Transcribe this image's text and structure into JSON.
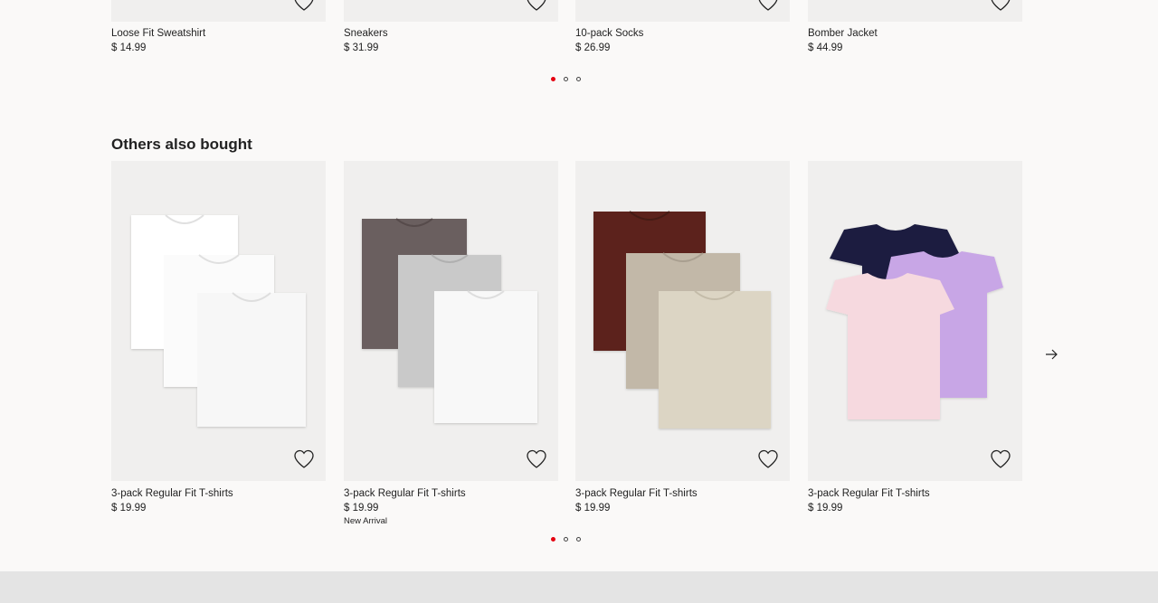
{
  "top_row": {
    "products": [
      {
        "name": "Loose Fit Sweatshirt",
        "price": "$ 14.99"
      },
      {
        "name": "Sneakers",
        "price": "$ 31.99"
      },
      {
        "name": "10-pack Socks",
        "price": "$ 26.99"
      },
      {
        "name": "Bomber Jacket",
        "price": "$ 44.99"
      }
    ],
    "pagination": {
      "pages": 3,
      "active": 1
    }
  },
  "others_also_bought": {
    "title": "Others also bought",
    "products": [
      {
        "name": "3-pack Regular Fit T-shirts",
        "price": "$ 19.99",
        "badge": "",
        "colors": [
          "#ffffff",
          "#fbfbfb",
          "#f5f5f5"
        ]
      },
      {
        "name": "3-pack Regular Fit T-shirts",
        "price": "$ 19.99",
        "badge": "New Arrival",
        "colors": [
          "#6b5e5e",
          "#c9c9c9",
          "#f8f8f8"
        ]
      },
      {
        "name": "3-pack Regular Fit T-shirts",
        "price": "$ 19.99",
        "badge": "",
        "colors": [
          "#5c241a",
          "#c2b8a8",
          "#dcd5c4"
        ]
      },
      {
        "name": "3-pack Regular Fit T-shirts",
        "price": "$ 19.99",
        "badge": "",
        "colors": [
          "#1b1d3f",
          "#c8a6e6",
          "#f6d9df"
        ]
      }
    ],
    "pagination": {
      "pages": 3,
      "active": 1
    }
  },
  "icons": {
    "favorite": "heart-icon",
    "next": "arrow-right-icon"
  },
  "colors": {
    "accent": "#e50010",
    "background": "#faf9f8",
    "image_bg": "#f0efee",
    "footer": "#e4e4e4"
  }
}
